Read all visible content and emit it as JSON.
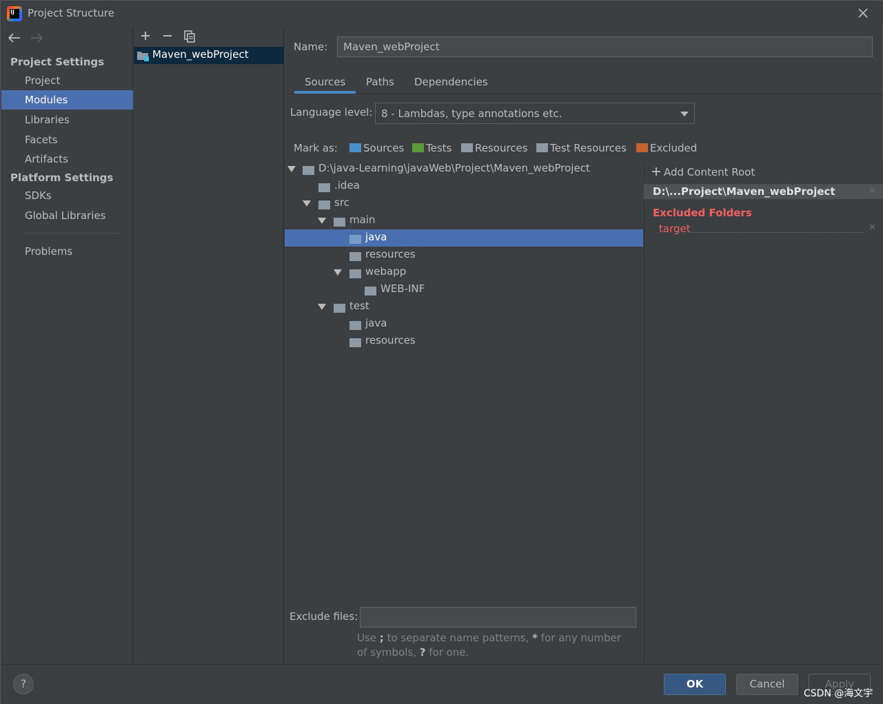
{
  "window": {
    "title": "Project Structure"
  },
  "nav": {
    "section_project": "Project Settings",
    "project_items": [
      {
        "label": "Project"
      },
      {
        "label": "Modules",
        "selected": true
      },
      {
        "label": "Libraries"
      },
      {
        "label": "Facets"
      },
      {
        "label": "Artifacts"
      }
    ],
    "section_platform": "Platform Settings",
    "platform_items": [
      {
        "label": "SDKs"
      },
      {
        "label": "Global Libraries"
      }
    ],
    "problems": "Problems"
  },
  "modules": {
    "toolbar": {
      "add": "+",
      "remove": "−",
      "copy": "copy"
    },
    "items": [
      {
        "label": "Maven_webProject"
      }
    ]
  },
  "module": {
    "name_label": "Name:",
    "name_value": "Maven_webProject",
    "tabs": [
      "Sources",
      "Paths",
      "Dependencies"
    ],
    "active_tab": "Sources",
    "language_label": "Language level:",
    "language_value": "8 - Lambdas, type annotations etc.",
    "mark_as_label": "Mark as:",
    "mark_as": {
      "sources": "Sources",
      "tests": "Tests",
      "resources": "Resources",
      "test_resources": "Test Resources",
      "excluded": "Excluded"
    },
    "tree": {
      "root": "D:\\java-Learning\\javaWeb\\Project\\Maven_webProject",
      "idea": ".idea",
      "src": "src",
      "main": "main",
      "main_java": "java",
      "main_resources": "resources",
      "webapp": "webapp",
      "webinf": "WEB-INF",
      "test": "test",
      "test_java": "java",
      "test_resources": "resources"
    },
    "content_root": {
      "add_label": "Add Content Root",
      "path": "D:\\...Project\\Maven_webProject",
      "excluded_title": "Excluded Folders",
      "excluded_items": [
        "target"
      ]
    },
    "exclude_files_label": "Exclude files:",
    "exclude_files_value": "",
    "hint_prefix": "Use ",
    "hint_semicolon": ";",
    "hint_mid": " to separate name patterns, ",
    "hint_star": "*",
    "hint_mid2": " for any number of symbols, ",
    "hint_q": "?",
    "hint_end": " for one."
  },
  "buttons": {
    "help": "?",
    "ok": "OK",
    "cancel": "Cancel",
    "apply": "Apply"
  },
  "watermark": "CSDN @海文宇",
  "colors": {
    "background": "#3c3f41",
    "selection": "#4b6eaf",
    "tab_underline": "#4a88c7",
    "excluded": "#f46060",
    "sources_folder": "#4a8fc6",
    "tests_folder": "#5a9a3a",
    "excluded_folder": "#c4622d"
  }
}
